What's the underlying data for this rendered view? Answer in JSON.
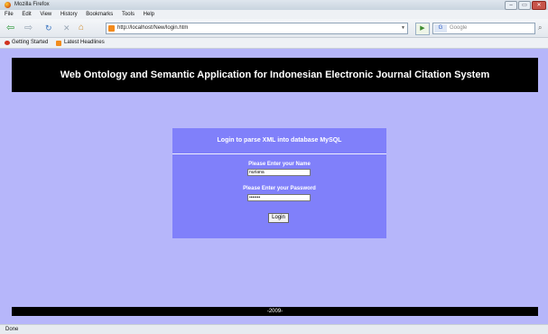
{
  "window": {
    "title": "Mozilla Firefox",
    "controls": [
      "–",
      "▭",
      "✕"
    ]
  },
  "menu": {
    "items": [
      "File",
      "Edit",
      "View",
      "History",
      "Bookmarks",
      "Tools",
      "Help"
    ]
  },
  "nav": {
    "back": "⇦",
    "forward": "⇨",
    "reload": "↻",
    "stop": "✕",
    "home": "⌂",
    "url": "http://localhost/New/login.htm",
    "go": "▶",
    "search_placeholder": "Google",
    "search_engine": "G",
    "search_go": "⌕"
  },
  "bookmarks": {
    "items": [
      "Getting Started",
      "Latest Headlines"
    ]
  },
  "page": {
    "banner": "Web Ontology and Semantic Application for Indonesian Electronic Journal Citation System",
    "login": {
      "header": "Login to parse XML into database MySQL",
      "name_label": "Please Enter your Name",
      "name_value": "nuriana",
      "password_label": "Please Enter your Password",
      "password_value": "•••••••",
      "button": "Login"
    },
    "footer": "-2009-"
  },
  "status": {
    "text": "Done"
  },
  "colors": {
    "page_bg": "#b6b6fa",
    "panel_bg": "#8080fa",
    "banner_bg": "#000000"
  }
}
